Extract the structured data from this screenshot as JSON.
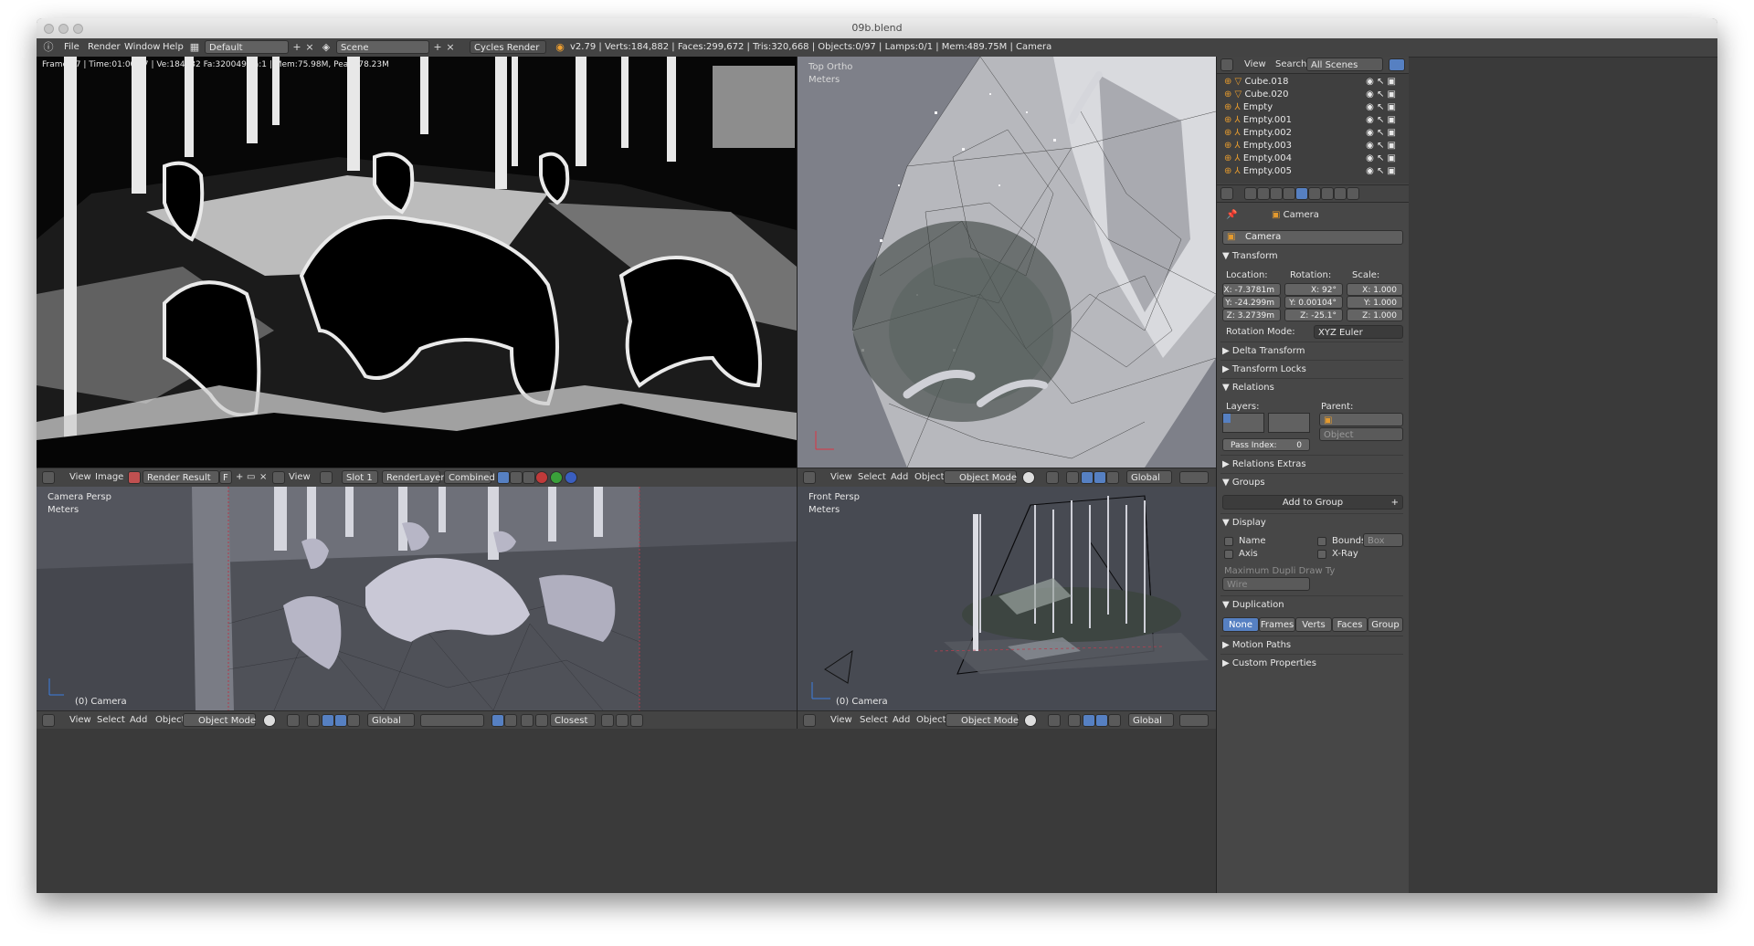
{
  "window": {
    "title": "09b.blend"
  },
  "infobar": {
    "menus": [
      "File",
      "Render",
      "Window",
      "Help"
    ],
    "layout": "Default",
    "scene": "Scene",
    "engine": "Cycles Render",
    "stats": "v2.79 | Verts:184,882 | Faces:299,672 | Tris:320,668 | Objects:0/97 | Lamps:0/1 | Mem:489.75M | Camera"
  },
  "image_editor": {
    "overlay": "Frame:17 | Time:01:00.07 | Ve:184032 Fa:320049 La:1 | Mem:75.98M, Peak: 78.23M",
    "header": {
      "view": "View",
      "image": "Image",
      "render_result": "Render Result",
      "fake_user": "F",
      "view2": "View",
      "slot": "Slot 1",
      "render_layer": "RenderLayer",
      "pass": "Combined"
    }
  },
  "viewport_top": {
    "label": "Top Ortho",
    "units": "Meters"
  },
  "viewport_camera": {
    "label": "Camera Persp",
    "units": "Meters",
    "object": "(0) Camera"
  },
  "viewport_front": {
    "label": "Front Persp",
    "units": "Meters",
    "object": "(0) Camera"
  },
  "vp_header": {
    "view": "View",
    "select": "Select",
    "add": "Add",
    "object": "Object",
    "mode": "Object Mode",
    "orientation": "Global",
    "snap": "Closest"
  },
  "outliner": {
    "view": "View",
    "search": "Search",
    "filter": "All Scenes",
    "items": [
      "Cube.018",
      "Cube.020",
      "Empty",
      "Empty.001",
      "Empty.002",
      "Empty.003",
      "Empty.004",
      "Empty.005"
    ]
  },
  "properties": {
    "context": "Camera",
    "object_name": "Camera",
    "transform": {
      "title": "Transform",
      "location_label": "Location:",
      "rotation_label": "Rotation:",
      "scale_label": "Scale:",
      "location": [
        "X: -7.3781m",
        "Y: -24.299m",
        "Z: 3.2739m"
      ],
      "rotation": [
        "X: 92°",
        "Y: 0.00104°",
        "Z: -25.1°"
      ],
      "scale": [
        "X: 1.000",
        "Y: 1.000",
        "Z: 1.000"
      ],
      "rotation_mode_label": "Rotation Mode:",
      "rotation_mode": "XYZ Euler"
    },
    "delta_transform": "Delta Transform",
    "transform_locks": "Transform Locks",
    "relations": {
      "title": "Relations",
      "layers": "Layers:",
      "parent": "Parent:",
      "parent_type": "Object",
      "pass_index": "Pass Index:",
      "pass_index_value": "0"
    },
    "relations_extras": "Relations Extras",
    "groups": {
      "title": "Groups",
      "add": "Add to Group"
    },
    "display": {
      "title": "Display",
      "name": "Name",
      "bounds": "Bounds",
      "bounds_type": "Box",
      "axis": "Axis",
      "xray": "X-Ray",
      "max_dupli": "Maximum Dupli Draw Ty",
      "max_dupli_value": "Wire"
    },
    "duplication": {
      "title": "Duplication",
      "options": [
        "None",
        "Frames",
        "Verts",
        "Faces",
        "Group"
      ]
    },
    "motion_paths": "Motion Paths",
    "custom_properties": "Custom Properties"
  }
}
